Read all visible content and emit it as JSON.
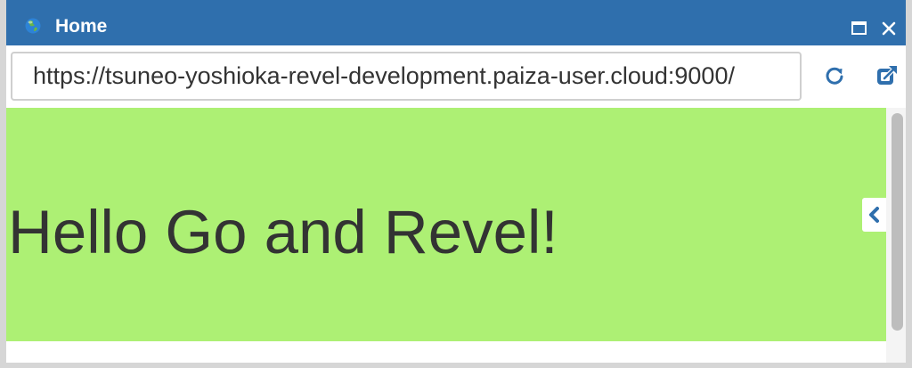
{
  "window": {
    "title": "Home",
    "icon": "globe-icon",
    "controls": [
      "maximize-icon",
      "close-icon"
    ]
  },
  "addressbar": {
    "url": "https://tsuneo-yoshioka-revel-development.paiza-user.cloud:9000/",
    "icons": [
      "refresh-icon",
      "open-external-icon"
    ]
  },
  "page": {
    "heading": "Hello Go and Revel!"
  },
  "side_panel": {
    "icon": "chevron-left-icon"
  },
  "colors": {
    "titlebar": "#2f6fad",
    "page_background": "#adf074",
    "accent": "#2f6fad",
    "text": "#333333"
  }
}
